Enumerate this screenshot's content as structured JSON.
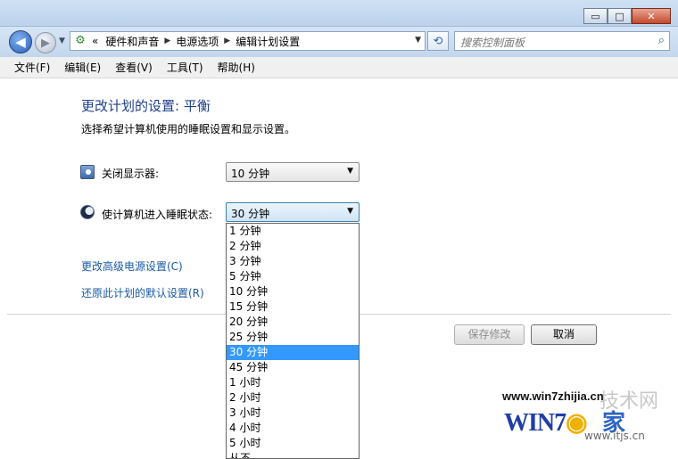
{
  "window": {
    "minimize": "▭",
    "maximize": "□",
    "close": "✕"
  },
  "nav": {
    "back_icon": "◀",
    "forward_icon": "▶",
    "history_dropdown": "▼",
    "address_prefix": "«",
    "breadcrumbs": [
      "硬件和声音",
      "电源选项",
      "编辑计划设置"
    ],
    "crumb_separator": "▶",
    "address_dropdown": "▼",
    "refresh_icon": "⟲",
    "search_placeholder": "搜索控制面板",
    "search_icon": "⌕"
  },
  "menu": [
    "文件(F)",
    "编辑(E)",
    "查看(V)",
    "工具(T)",
    "帮助(H)"
  ],
  "page": {
    "title": "更改计划的设置: 平衡",
    "subtitle": "选择希望计算机使用的睡眠设置和显示设置。"
  },
  "settings": {
    "display": {
      "label": "关闭显示器:",
      "value": "10 分钟",
      "icon": "monitor-clock-icon"
    },
    "sleep": {
      "label": "使计算机进入睡眠状态:",
      "value": "30 分钟",
      "icon": "moon-icon",
      "options": [
        "1 分钟",
        "2 分钟",
        "3 分钟",
        "5 分钟",
        "10 分钟",
        "15 分钟",
        "20 分钟",
        "25 分钟",
        "30 分钟",
        "45 分钟",
        "1 小时",
        "2 小时",
        "3 小时",
        "4 小时",
        "5 小时",
        "从不"
      ],
      "selected_index": 8
    }
  },
  "links": {
    "advanced": "更改高级电源设置(C)",
    "restore": "还原此计划的默认设置(R)"
  },
  "buttons": {
    "save": "保存修改",
    "cancel": "取消"
  },
  "watermark": {
    "url": "www.win7zhijia.cn",
    "logo": "WIN7",
    "logo_ball": "◉",
    "home": "家",
    "url2": "www.itjs.cn",
    "site_mark": "技术网"
  },
  "colors": {
    "title": "#1e3f8a",
    "link": "#1a5aa6",
    "selection": "#3399ff"
  }
}
